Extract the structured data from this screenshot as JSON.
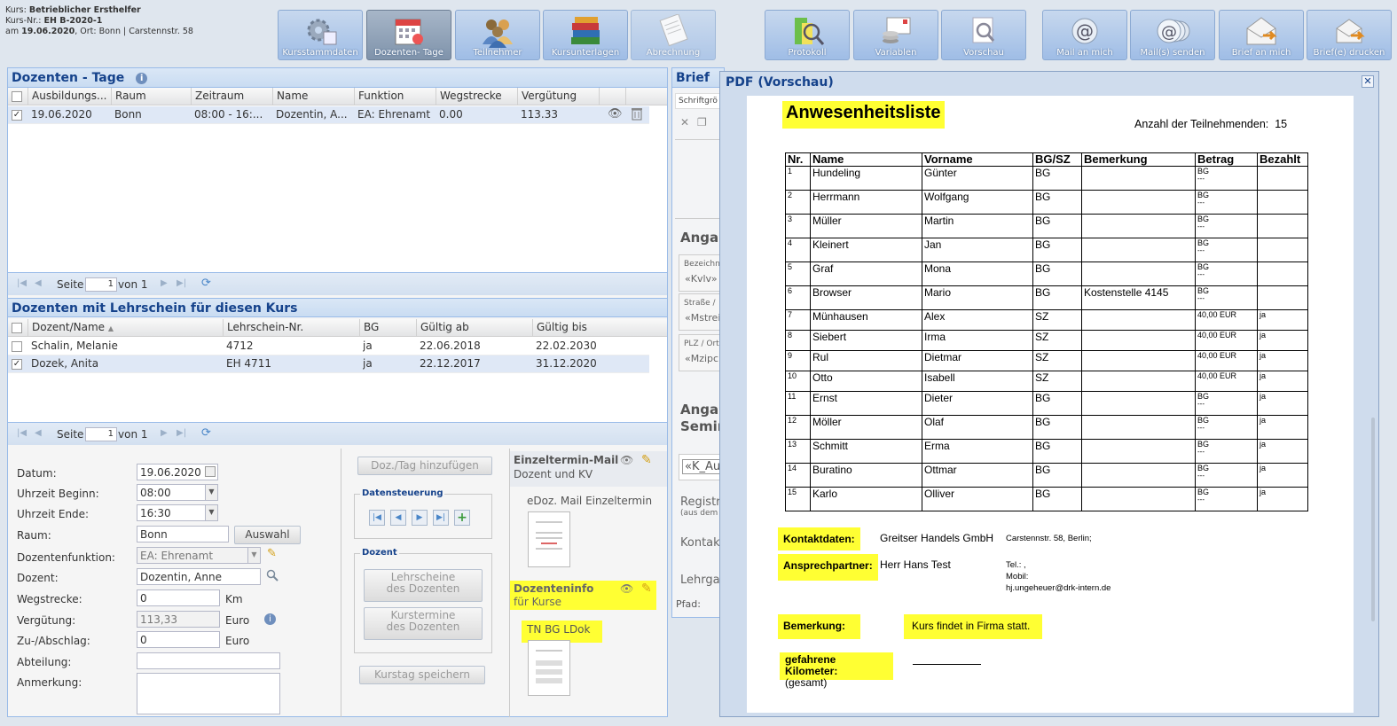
{
  "kurs": {
    "line1_label": "Kurs:",
    "line1_value": "Betrieblicher Ersthelfer",
    "line2_label": "Kurs-Nr.:",
    "line2_value": "EH B-2020-1",
    "line3_prefix": "am",
    "line3_date": "19.06.2020",
    "line3_rest": ", Ort: Bonn | Carstennstr. 58"
  },
  "toolbar": [
    {
      "label": "Kursstammdaten",
      "icon": "settings-icon"
    },
    {
      "label": "Dozenten- Tage",
      "icon": "calendar-icon",
      "active": true
    },
    {
      "label": "Teilnehmer",
      "icon": "users-icon"
    },
    {
      "label": "Kursunterlagen",
      "icon": "books-icon"
    },
    {
      "label": "Abrechnung",
      "icon": "invoice-icon"
    },
    {
      "label": "Protokoll",
      "icon": "report-icon"
    },
    {
      "label": "Variablen",
      "icon": "variables-icon"
    },
    {
      "label": "Vorschau",
      "icon": "preview-icon"
    },
    {
      "label": "Mail an mich",
      "icon": "at-icon"
    },
    {
      "label": "Mail(s) senden",
      "icon": "at-multi-icon"
    },
    {
      "label": "Brief an mich",
      "icon": "letter-icon"
    },
    {
      "label": "Brief(e) drucken",
      "icon": "letter-print-icon"
    }
  ],
  "dozenten_tage": {
    "title": "Dozenten - Tage",
    "columns": [
      "Ausbildungs...",
      "Raum",
      "Zeitraum",
      "Name",
      "Funktion",
      "Wegstrecke",
      "Vergütung"
    ],
    "rows": [
      {
        "checked": true,
        "cells": [
          "19.06.2020",
          "Bonn",
          "08:00 - 16:...",
          "Dozentin, A...",
          "EA: Ehrenamt",
          "0.00",
          "113.33"
        ]
      }
    ],
    "pager": {
      "page_label": "Seite",
      "page": "1",
      "of_label": "von 1"
    }
  },
  "lehrschein": {
    "title": "Dozenten mit Lehrschein für diesen Kurs",
    "columns": [
      "Dozent/Name",
      "Lehrschein-Nr.",
      "BG",
      "Gültig ab",
      "Gültig bis"
    ],
    "rows": [
      {
        "checked": false,
        "cells": [
          "Schalin, Melanie",
          "4712",
          "ja",
          "22.06.2018",
          "22.02.2030"
        ]
      },
      {
        "checked": true,
        "cells": [
          "Dozek, Anita",
          "EH 4711",
          "ja",
          "22.12.2017",
          "31.12.2020"
        ]
      }
    ],
    "pager": {
      "page_label": "Seite",
      "page": "1",
      "of_label": "von 1"
    }
  },
  "form": {
    "datum": {
      "label": "Datum:",
      "value": "19.06.2020"
    },
    "beginn": {
      "label": "Uhrzeit Beginn:",
      "value": "08:00"
    },
    "ende": {
      "label": "Uhrzeit Ende:",
      "value": "16:30"
    },
    "raum": {
      "label": "Raum:",
      "value": "Bonn",
      "button": "Auswahl"
    },
    "funktion": {
      "label": "Dozentenfunktion:",
      "value": "EA: Ehrenamt"
    },
    "dozent": {
      "label": "Dozent:",
      "value": "Dozentin, Anne"
    },
    "wegstrecke": {
      "label": "Wegstrecke:",
      "value": "0",
      "unit": "Km"
    },
    "verguetung": {
      "label": "Vergütung:",
      "value": "113,33",
      "unit": "Euro"
    },
    "zuabschlag": {
      "label": "Zu-/Abschlag:",
      "value": "0",
      "unit": "Euro"
    },
    "abteilung": {
      "label": "Abteilung:",
      "value": ""
    },
    "anmerkung": {
      "label": "Anmerkung:",
      "value": ""
    }
  },
  "actions": {
    "add_button": "Doz./Tag hinzufügen",
    "datensteuerung_label": "Datensteuerung",
    "dozent_label": "Dozent",
    "lehrscheine_button_1": "Lehrscheine",
    "lehrscheine_button_2": "des Dozenten",
    "kurstermine_button_1": "Kurstermine",
    "kurstermine_button_2": "des Dozenten",
    "save_button": "Kurstag speichern"
  },
  "docs": {
    "einzeltermin_title": "Einzeltermin-Mail",
    "einzeltermin_sub": "Dozent und KV",
    "edoz_label": "eDoz. Mail Einzeltermin",
    "dozenteninfo_title": "Dozenteninfo",
    "dozenteninfo_sub": "für Kurse",
    "tn_label": "TN BG LDok"
  },
  "brief": {
    "title": "Brief",
    "schriftgroesse": "Schriftgrö",
    "angaben1": "Angal",
    "bezeichnung": "Bezeichn",
    "kvlv": "«Kvlv»",
    "strasse": "Straße /",
    "mstrei": "«Mstrei",
    "plz": "PLZ / Ort",
    "mzipc": "«Mzipc",
    "angaben2": "Angal",
    "semin": "Semin",
    "k_au": "«K_Au",
    "registr": "Registr",
    "aus_dem": "(aus dem",
    "kontakt": "Kontak",
    "lehrgang": "Lehrgan",
    "pfad": "Pfad:"
  },
  "pdf": {
    "window_title": "PDF (Vorschau)",
    "heading": "Anwesenheitsliste",
    "count_label": "Anzahl der Teilnehmenden:",
    "count_value": "15",
    "columns": [
      "Nr.",
      "Name",
      "Vorname",
      "BG/SZ",
      "Bemerkung",
      "Betrag",
      "Bezahlt"
    ],
    "rows": [
      [
        "1",
        "Hundeling",
        "Günter",
        "BG",
        "",
        "BG",
        ""
      ],
      [
        "2",
        "Herrmann",
        "Wolfgang",
        "BG",
        "",
        "BG",
        ""
      ],
      [
        "3",
        "Müller",
        "Martin",
        "BG",
        "",
        "BG",
        ""
      ],
      [
        "4",
        "Kleinert",
        "Jan",
        "BG",
        "",
        "BG",
        ""
      ],
      [
        "5",
        "Graf",
        "Mona",
        "BG",
        "",
        "BG",
        ""
      ],
      [
        "6",
        "Browser",
        "Mario",
        "BG",
        "Kostenstelle 4145",
        "BG",
        ""
      ],
      [
        "7",
        "Münhausen",
        "Alex",
        "SZ",
        "",
        "40,00 EUR",
        "ja"
      ],
      [
        "8",
        "Siebert",
        "Irma",
        "SZ",
        "",
        "40,00 EUR",
        "ja"
      ],
      [
        "9",
        "Rul",
        "Dietmar",
        "SZ",
        "",
        "40,00 EUR",
        "ja"
      ],
      [
        "10",
        "Otto",
        "Isabell",
        "SZ",
        "",
        "40,00 EUR",
        "ja"
      ],
      [
        "11",
        "Ernst",
        "Dieter",
        "BG",
        "",
        "BG",
        "ja"
      ],
      [
        "12",
        "Möller",
        "Olaf",
        "BG",
        "",
        "BG",
        "ja"
      ],
      [
        "13",
        "Schmitt",
        "Erma",
        "BG",
        "",
        "BG",
        "ja"
      ],
      [
        "14",
        "Buratino",
        "Ottmar",
        "BG",
        "",
        "BG",
        "ja"
      ],
      [
        "15",
        "Karlo",
        "Olliver",
        "BG",
        "",
        "BG",
        "ja"
      ]
    ],
    "kontakt_label": "Kontaktdaten:",
    "kontakt_firma": "Greitser Handels GmbH",
    "kontakt_adresse": "Carstennstr. 58, Berlin;",
    "ansprech_label": "Ansprechpartner:",
    "ansprech_name": "Herr Hans Test",
    "tel": "Tel.: ,",
    "mobil": "Mobil:",
    "email": "hj.ungeheuer@drk-intern.de",
    "bemerkung_label": "Bemerkung:",
    "bemerkung_text": "Kurs findet in Firma statt.",
    "km_label": "gefahrene Kilometer:",
    "km_sub": "(gesamt)"
  },
  "colors": {
    "highlight": "#ffff33",
    "panel_title": "#15428b",
    "toolbar": "#9fbde6"
  }
}
